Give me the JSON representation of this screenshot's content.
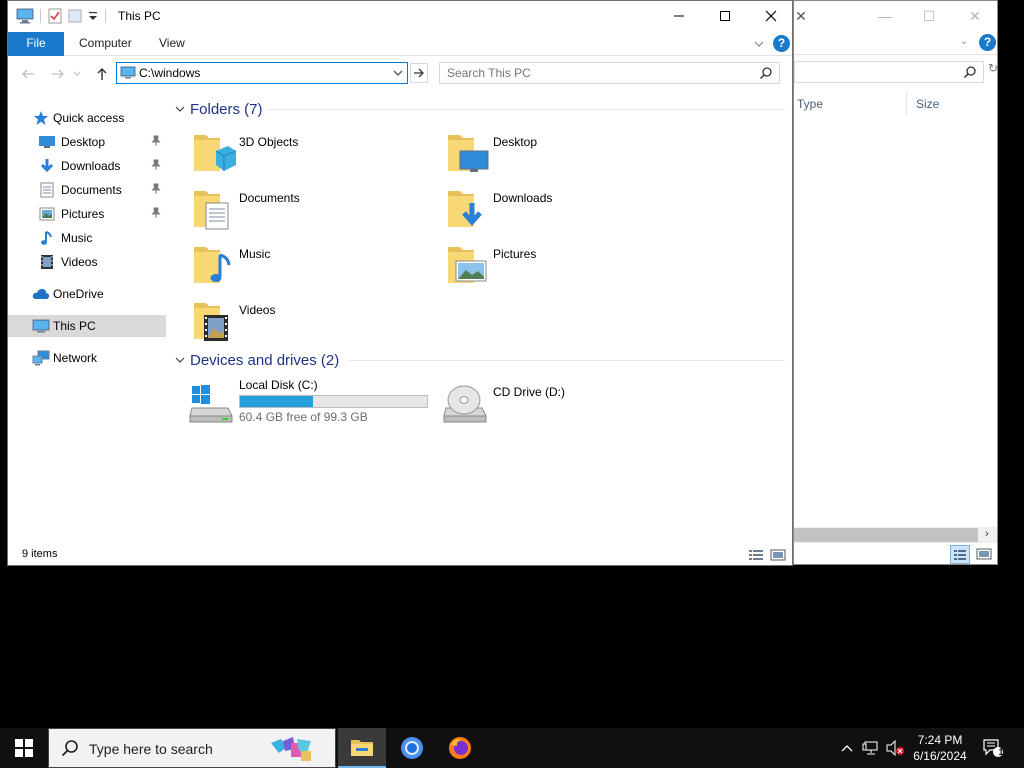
{
  "window": {
    "title": "This PC",
    "tabs": {
      "file": "File",
      "computer": "Computer",
      "view": "View"
    },
    "help": "?"
  },
  "address": {
    "value": "C:\\windows"
  },
  "search": {
    "placeholder": "Search This PC"
  },
  "nav": {
    "quick_access": "Quick access",
    "desktop": "Desktop",
    "downloads": "Downloads",
    "documents": "Documents",
    "pictures": "Pictures",
    "music": "Music",
    "videos": "Videos",
    "onedrive": "OneDrive",
    "this_pc": "This PC",
    "network": "Network"
  },
  "folders": {
    "header": "Folders (7)",
    "items": [
      "3D Objects",
      "Desktop",
      "Documents",
      "Downloads",
      "Music",
      "Pictures",
      "Videos"
    ]
  },
  "drives": {
    "header": "Devices and drives (2)",
    "local": {
      "label": "Local Disk (C:)",
      "free": "60.4 GB free of 99.3 GB",
      "used_fraction": 0.392
    },
    "cd": {
      "label": "CD Drive (D:)"
    }
  },
  "status": {
    "items": "9 items"
  },
  "background_window": {
    "columns": {
      "type": "Type",
      "size": "Size"
    },
    "help": "?"
  },
  "taskbar": {
    "search_placeholder": "Type here to search",
    "time": "7:24 PM",
    "date": "6/16/2024",
    "notifications": "1"
  },
  "colors": {
    "accent": "#1979ca",
    "drive_fill": "#26a0da",
    "group_header": "#1e3287",
    "folder": "#f8d775"
  }
}
